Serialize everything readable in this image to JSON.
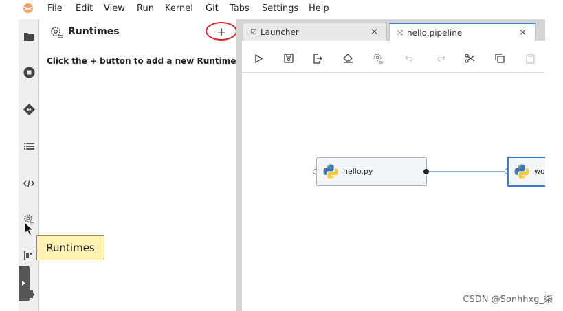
{
  "menubar": {
    "items": [
      "File",
      "Edit",
      "View",
      "Run",
      "Kernel",
      "Git",
      "Tabs",
      "Settings",
      "Help"
    ]
  },
  "activity_bar": {
    "icons": [
      "folder-icon",
      "stop-circle-icon",
      "git-icon",
      "table-of-contents-icon",
      "code-snippets-icon",
      "runtimes-icon",
      "component-catalog-icon",
      "extensions-icon"
    ]
  },
  "left_panel": {
    "title": "Runtimes",
    "add_label": "+",
    "hint": "Click the + button to add a new Runtime"
  },
  "tabs": [
    {
      "label": "Launcher",
      "close": "×",
      "active": false
    },
    {
      "label": "hello.pipeline",
      "close": "×",
      "active": true
    }
  ],
  "pipeline": {
    "nodes": [
      {
        "label": "hello.py"
      },
      {
        "label": "wo"
      }
    ]
  },
  "tooltip": {
    "text": "Runtimes"
  },
  "watermark": "CSDN @Sonhhxg_柒",
  "colors": {
    "accent": "#3b7bd4",
    "highlight_circle": "#d9252a",
    "tooltip_bg": "#fff2b3"
  }
}
